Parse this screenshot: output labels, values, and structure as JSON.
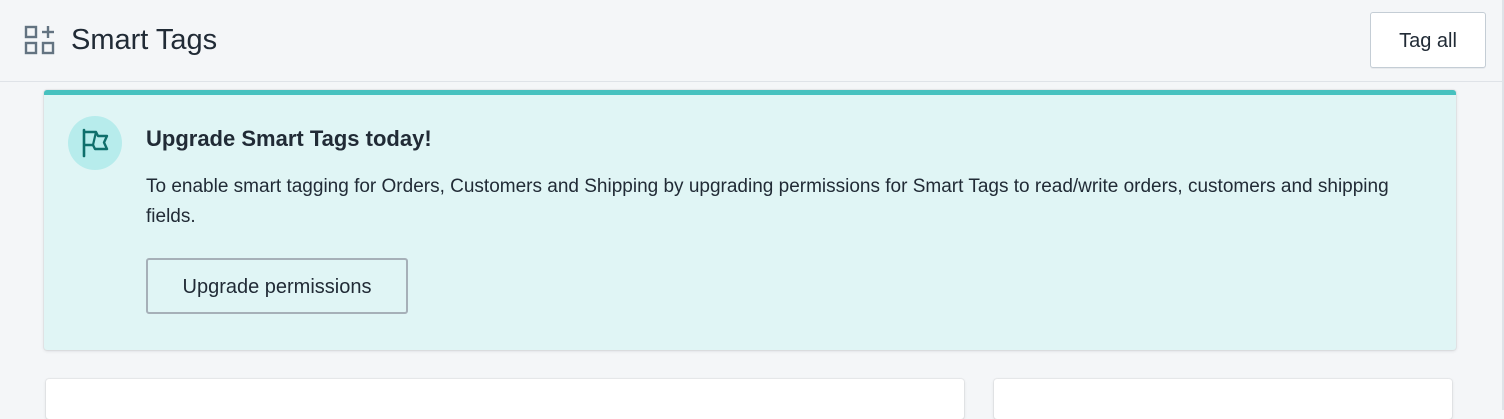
{
  "header": {
    "app_icon": "apps-add-icon",
    "title": "Smart Tags",
    "tag_all_label": "Tag all"
  },
  "banner": {
    "icon": "flag-icon",
    "title": "Upgrade Smart Tags today!",
    "body": "To enable smart tagging for Orders, Customers and Shipping by upgrading permissions for Smart Tags to read/write orders, customers and shipping fields.",
    "button_label": "Upgrade permissions",
    "accent_color": "#47c1bf",
    "background_color": "#e0f5f5"
  }
}
